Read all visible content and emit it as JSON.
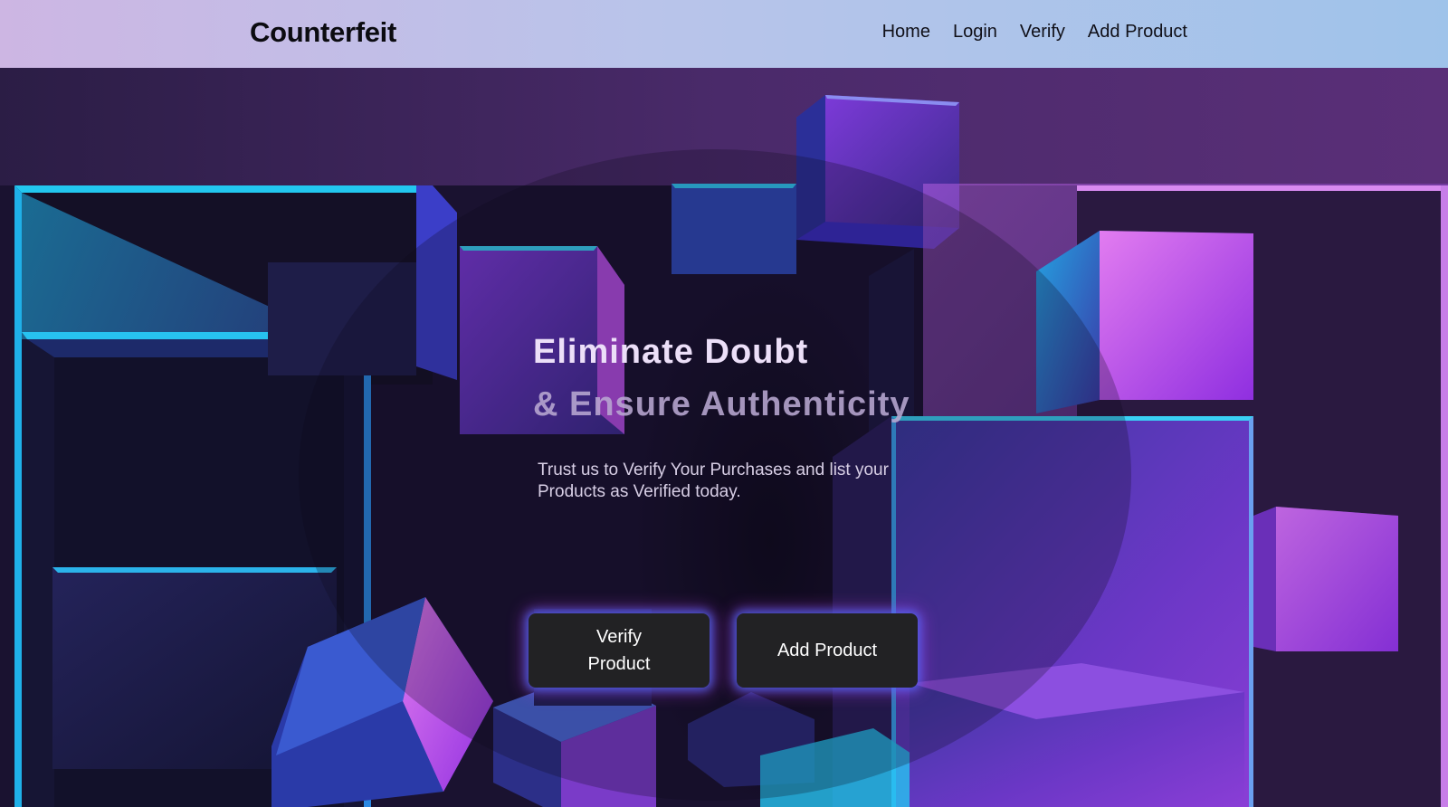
{
  "navbar": {
    "brand": "Counterfeit",
    "links": [
      "Home",
      "Login",
      "Verify",
      "Add Product"
    ]
  },
  "hero": {
    "headline_line1": "Eliminate Doubt",
    "headline_line2": "& Ensure Authenticity",
    "subtext": "Trust us to Verify Your Purchases and list your Products as Verified today.",
    "buttons": {
      "verify_label": "Verify Product",
      "add_label": "Add Product"
    }
  },
  "colors": {
    "accent_cyan": "#22c7ef",
    "accent_purple": "#a63ee0",
    "deep_indigo": "#2a1f6e",
    "button_bg": "#222224"
  }
}
